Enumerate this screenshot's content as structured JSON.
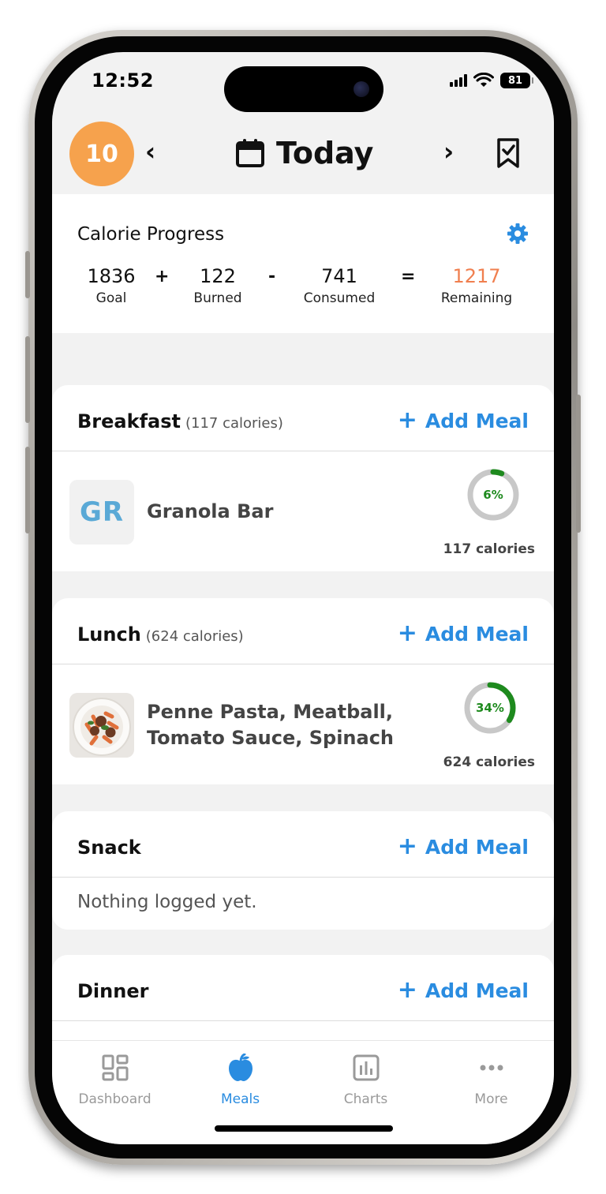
{
  "status_bar": {
    "time": "12:52",
    "battery": "81"
  },
  "header": {
    "streak": "10",
    "title": "Today",
    "prev": "‹",
    "next": "›"
  },
  "calorie_progress": {
    "title": "Calorie Progress",
    "goal": {
      "value": "1836",
      "label": "Goal"
    },
    "burned": {
      "value": "122",
      "label": "Burned"
    },
    "consumed": {
      "value": "741",
      "label": "Consumed"
    },
    "remaining": {
      "value": "1217",
      "label": "Remaining"
    },
    "op_plus": "+",
    "op_minus": "-",
    "op_equals": "="
  },
  "add_meal_label": "Add Meal",
  "add_meal_plus": "+",
  "meals": [
    {
      "name": "Breakfast",
      "calories": "(117 calories)",
      "items": [
        {
          "thumb": "GR",
          "name": "Granola Bar",
          "percent": "6%",
          "percent_value": 0.06,
          "calories": "117 calories"
        }
      ]
    },
    {
      "name": "Lunch",
      "calories": "(624 calories)",
      "items": [
        {
          "name_line1": "Penne Pasta, Meatball,",
          "name_line2": "Tomato Sauce, Spinach",
          "percent": "34%",
          "percent_value": 0.34,
          "calories": "624 calories"
        }
      ]
    },
    {
      "name": "Snack",
      "empty": "Nothing logged yet."
    },
    {
      "name": "Dinner"
    }
  ],
  "tabs": [
    {
      "label": "Dashboard",
      "icon": "dashboard-icon"
    },
    {
      "label": "Meals",
      "icon": "apple-icon",
      "active": true
    },
    {
      "label": "Charts",
      "icon": "chart-icon"
    },
    {
      "label": "More",
      "icon": "more-icon"
    }
  ],
  "colors": {
    "accent": "#2a8ce0",
    "streak": "#f6a24d",
    "remaining": "#f07f4f",
    "ring_progress": "#1e8a1e",
    "ring_track": "#c8c8c8"
  }
}
